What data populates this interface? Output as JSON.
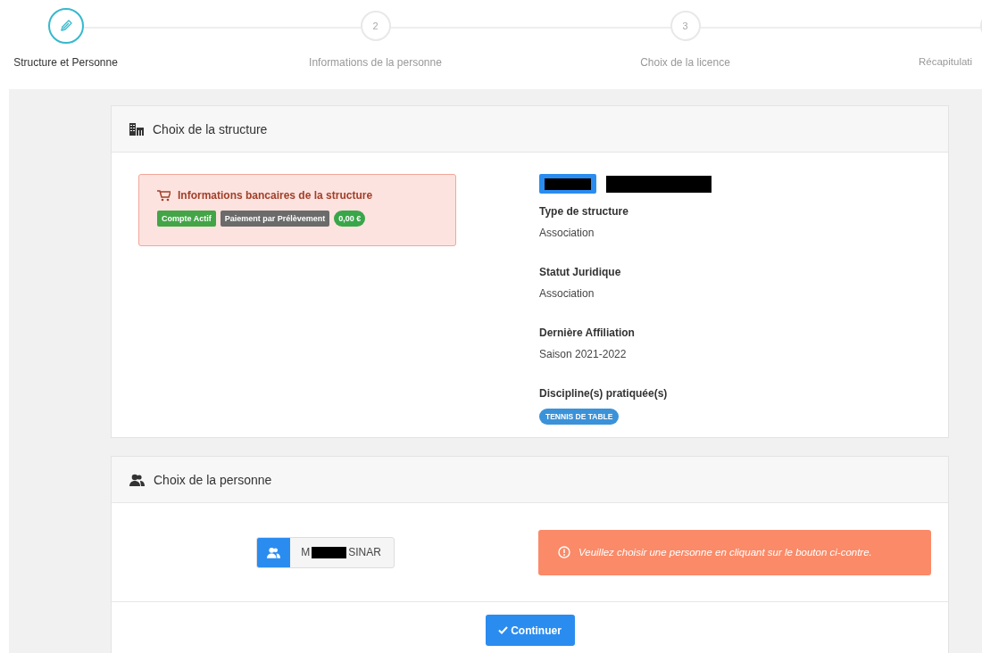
{
  "stepper": {
    "steps": [
      {
        "kind": "icon",
        "label": "Structure et Personne",
        "selected": true
      },
      {
        "kind": "number",
        "marker": "2",
        "label": "Informations de la personne",
        "selected": false
      },
      {
        "kind": "number",
        "marker": "3",
        "label": "Choix de la licence",
        "selected": false
      },
      {
        "kind": "number",
        "label": "Récapitulati",
        "selected": false
      }
    ]
  },
  "structure_card": {
    "title": "Choix de la structure",
    "bank_alert": {
      "title": "Informations bancaires de la structure",
      "badges": [
        {
          "text": "Compte Actif",
          "color": "#43a547"
        },
        {
          "text": "Paiement par Prélèvement",
          "color": "#6b6b6b"
        },
        {
          "text": "0,00 €",
          "color": "#3aa64a",
          "kind": "pill"
        }
      ]
    },
    "fields": [
      {
        "label": "Type de structure",
        "value": "Association"
      },
      {
        "label": "Statut Juridique",
        "value": "Association"
      },
      {
        "label": "Dernière Affiliation",
        "value": "Saison 2021-2022"
      }
    ],
    "disciplines": {
      "label": "Discipline(s) pratiquée(s)",
      "tags": [
        "TENNIS DE TABLE"
      ]
    }
  },
  "person_card": {
    "title": "Choix de la personne",
    "person_button": {
      "prefix": "M",
      "suffix": "SINAR"
    },
    "warning": "Veuillez choisir une personne en cliquant sur le bouton ci-contre.",
    "continue_button": "Continuer"
  }
}
